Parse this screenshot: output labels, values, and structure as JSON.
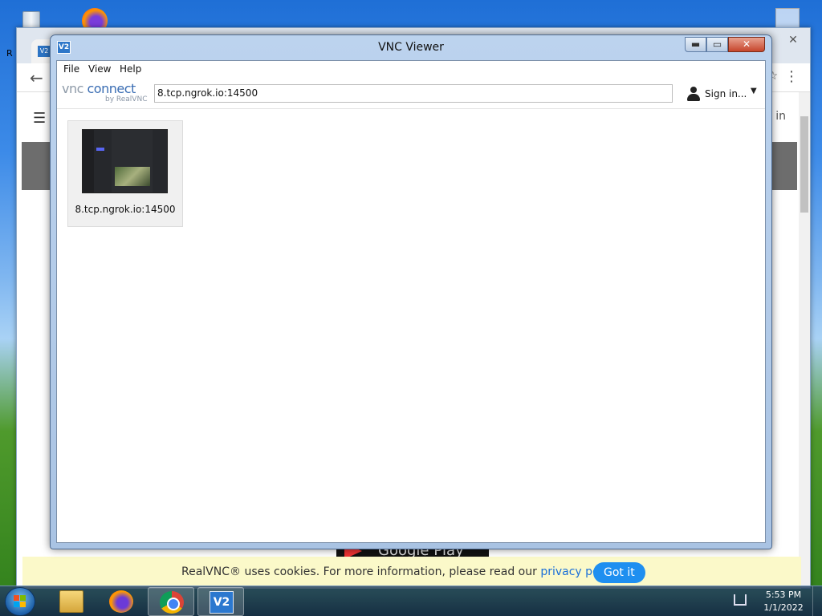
{
  "desktop": {
    "partial_label": "R"
  },
  "browser": {
    "tab_icon_text": "V2",
    "tab_close": "✕",
    "new_tab": "+",
    "window_close": "✕",
    "back": "←",
    "star": "☆",
    "menu": "⋮",
    "hamburger": "☰",
    "signin_partial": "n in",
    "gplay_text": "Google Play",
    "cookie": {
      "text_before": "RealVNC® uses cookies. For more information, please read our ",
      "link": "privacy policy",
      "text_after": ".",
      "button": "Got it"
    }
  },
  "vnc": {
    "title": "VNC Viewer",
    "app_icon_text": "V2",
    "controls": {
      "minimize": "▬",
      "maximize": "▭",
      "close": "✕"
    },
    "menu": [
      "File",
      "View",
      "Help"
    ],
    "logo": {
      "main_vnc": "vnc",
      "main_connect": "connect",
      "sub": "by RealVNC"
    },
    "address_value": "8.tcp.ngrok.io:14500",
    "signin_label": "Sign in...",
    "signin_caret": "▼",
    "connections": [
      {
        "label": "8.tcp.ngrok.io:14500"
      }
    ]
  },
  "taskbar": {
    "vnc_icon_text": "V2",
    "time": "5:53 PM",
    "date": "1/1/2022"
  },
  "colors": {
    "accent": "#1f8ff0",
    "vnc_blue": "#2e77c9",
    "cookie_bg": "#fbf9c9"
  },
  "icons": [
    "recycle-bin-icon",
    "firefox-icon",
    "chrome-icon",
    "explorer-icon",
    "vnc-icon",
    "user-icon",
    "network-icon",
    "windows-start-icon"
  ]
}
